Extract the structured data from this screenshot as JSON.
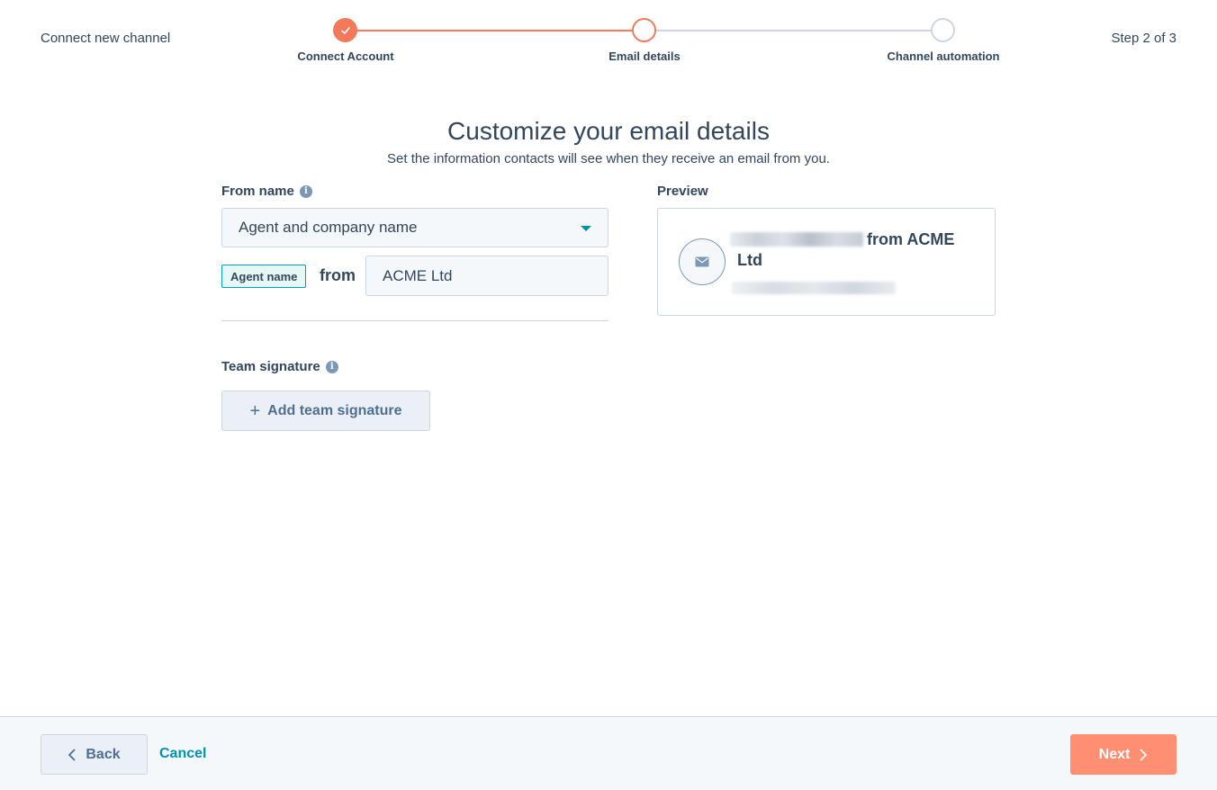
{
  "header": {
    "title": "Connect new channel",
    "step_count": "Step 2 of 3",
    "steps": [
      {
        "label": "Connect Account",
        "state": "completed"
      },
      {
        "label": "Email details",
        "state": "active"
      },
      {
        "label": "Channel automation",
        "state": "upcoming"
      }
    ]
  },
  "main": {
    "title": "Customize your email details",
    "subtitle": "Set the information contacts will see when they receive an email from you.",
    "from_name": {
      "label": "From name",
      "info_icon": "info-icon",
      "selected": "Agent and company name",
      "agent_tag": "Agent name",
      "from_word": "from",
      "company_value": "ACME Ltd"
    },
    "team_signature": {
      "label": "Team signature",
      "info_icon": "info-icon",
      "add_button": "Add team signature"
    },
    "preview": {
      "label": "Preview",
      "sender_suffix": "from ACME",
      "sender_line2": "Ltd"
    }
  },
  "footer": {
    "back_label": "Back",
    "cancel_label": "Cancel",
    "next_label": "Next"
  },
  "colors": {
    "accent": "#f2795a",
    "next_button": "#ff8f73",
    "link": "#0091ae",
    "text": "#33475b"
  }
}
